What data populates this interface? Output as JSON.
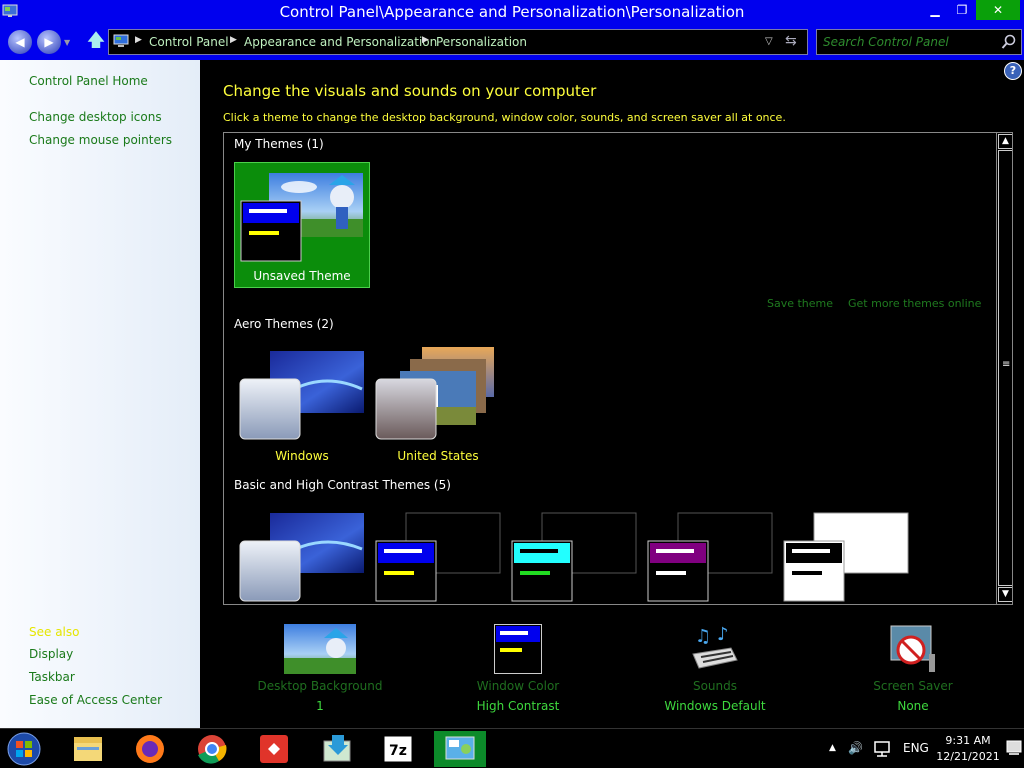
{
  "window": {
    "title": "Control Panel\\Appearance and Personalization\\Personalization",
    "minimize_label": "▁",
    "maximize_label": "❐",
    "close_label": "✕"
  },
  "address_bar": {
    "breadcrumbs": [
      "Control Panel",
      "Appearance and Personalization",
      "Personalization"
    ],
    "icons": [
      "back-arrow-icon",
      "forward-arrow-icon",
      "up-arrow-icon",
      "computer-icon",
      "refresh-icon"
    ]
  },
  "search": {
    "placeholder": "Search Control Panel",
    "icon": "magnifier-icon"
  },
  "sidebar": {
    "home_link": "Control Panel Home",
    "task_links": [
      "Change desktop icons",
      "Change mouse pointers"
    ],
    "see_also_heading": "See also",
    "see_also_links": [
      "Display",
      "Taskbar",
      "Ease of Access Center"
    ]
  },
  "main": {
    "heading": "Change the visuals and sounds on your computer",
    "subheading": "Click a theme to change the desktop background, window color, sounds, and screen saver all at once.",
    "help_label": "?",
    "my_themes": {
      "title": "My Themes (1)",
      "items": [
        {
          "label": "Unsaved Theme",
          "selected": true
        }
      ]
    },
    "theme_links": {
      "save": "Save theme",
      "get_more": "Get more themes online"
    },
    "aero_themes": {
      "title": "Aero Themes (2)",
      "items": [
        {
          "label": "Windows"
        },
        {
          "label": "United States"
        }
      ]
    },
    "basic_themes": {
      "title": "Basic and High Contrast Themes (5)"
    }
  },
  "settings": [
    {
      "name": "Desktop Background",
      "value": "1"
    },
    {
      "name": "Window Color",
      "value": "High Contrast"
    },
    {
      "name": "Sounds",
      "value": "Windows Default"
    },
    {
      "name": "Screen Saver",
      "value": "None"
    }
  ],
  "taskbar": {
    "apps": [
      "file-explorer-icon",
      "firefox-icon",
      "chrome-icon",
      "anydesk-icon",
      "installer-icon",
      "7zip-icon",
      "control-panel-icon"
    ],
    "sevenzip_label": "7z",
    "language": "ENG",
    "time": "9:31 AM",
    "date": "12/21/2021",
    "tray_icons": [
      "show-hidden-icon",
      "volume-icon",
      "network-icon"
    ]
  },
  "colors": {
    "title_bar": "#0000ee",
    "heading": "#ffff3c",
    "link": "#1a7a1a",
    "selection": "#0b8d0b",
    "close_button": "#0aa00a"
  }
}
